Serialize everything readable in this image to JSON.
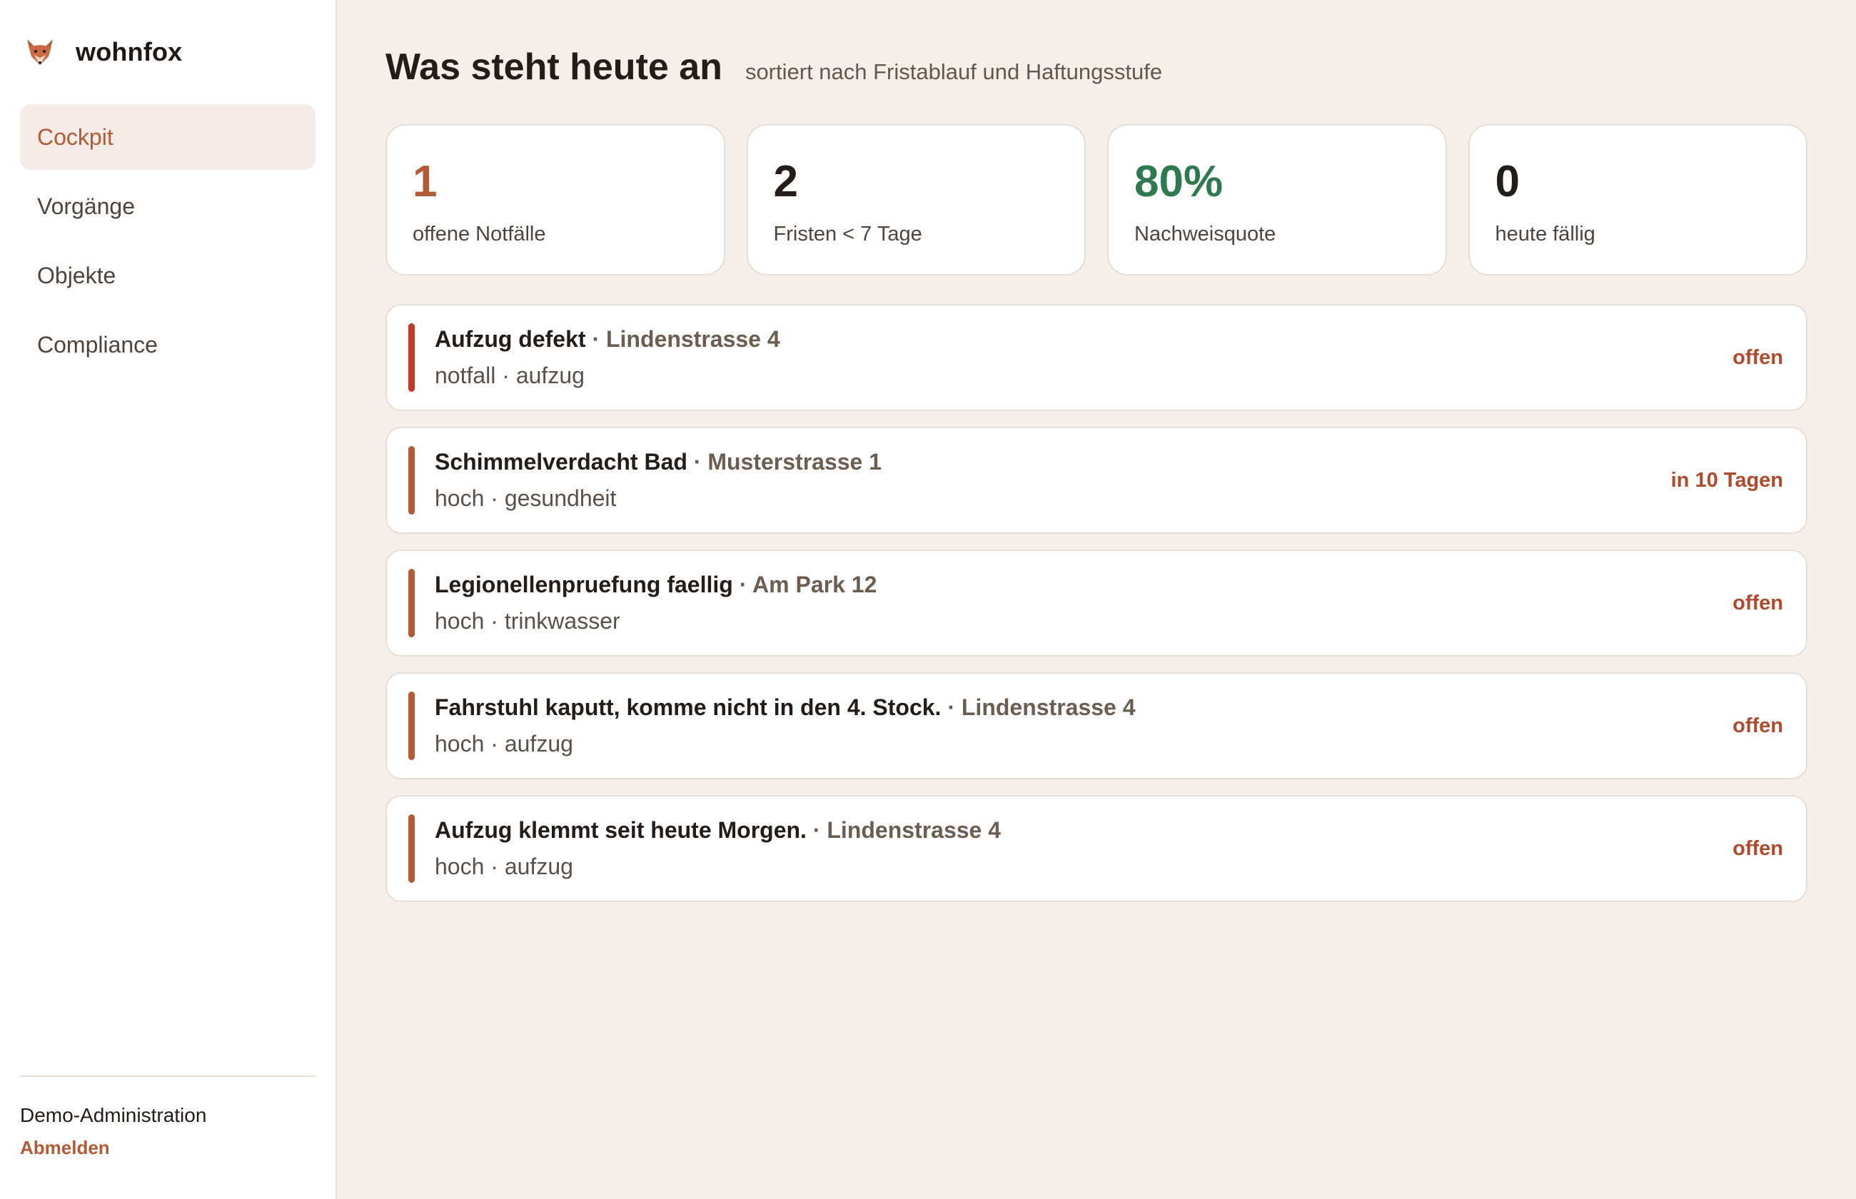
{
  "app": {
    "name": "wohnfox",
    "logo_icon": "fox-icon"
  },
  "colors": {
    "accent": "#b35a36",
    "success": "#2e7a4e",
    "notfall": "#c0392b",
    "hoch": "#b35a36",
    "text": "#241c18",
    "background": "#f6eee8"
  },
  "sidebar": {
    "items": [
      {
        "label": "Cockpit",
        "active": true
      },
      {
        "label": "Vorgänge",
        "active": false
      },
      {
        "label": "Objekte",
        "active": false
      },
      {
        "label": "Compliance",
        "active": false
      }
    ],
    "user": "Demo-Administration",
    "logout_label": "Abmelden"
  },
  "header": {
    "title": "Was steht heute an",
    "subtitle": "sortiert nach Fristablauf und Haftungsstufe"
  },
  "kpis": [
    {
      "value": "1",
      "label": "offene Notfälle",
      "color": "#b35a36"
    },
    {
      "value": "2",
      "label": "Fristen < 7 Tage",
      "color": "#241c18"
    },
    {
      "value": "80%",
      "label": "Nachweisquote",
      "color": "#2e7a4e"
    },
    {
      "value": "0",
      "label": "heute fällig",
      "color": "#241c18"
    }
  ],
  "items": [
    {
      "title": "Aufzug defekt",
      "location": "Lindenstrasse 4",
      "meta": "notfall · aufzug",
      "status": "offen",
      "severity": "notfall"
    },
    {
      "title": "Schimmelverdacht Bad",
      "location": "Musterstrasse 1",
      "meta": "hoch · gesundheit",
      "status": "in 10 Tagen",
      "severity": "hoch"
    },
    {
      "title": "Legionellenpruefung faellig",
      "location": "Am Park 12",
      "meta": "hoch · trinkwasser",
      "status": "offen",
      "severity": "hoch"
    },
    {
      "title": "Fahrstuhl kaputt, komme nicht in den 4. Stock.",
      "location": "Lindenstrasse 4",
      "meta": "hoch · aufzug",
      "status": "offen",
      "severity": "hoch"
    },
    {
      "title": "Aufzug klemmt seit heute Morgen.",
      "location": "Lindenstrasse 4",
      "meta": "hoch · aufzug",
      "status": "offen",
      "severity": "hoch"
    }
  ]
}
